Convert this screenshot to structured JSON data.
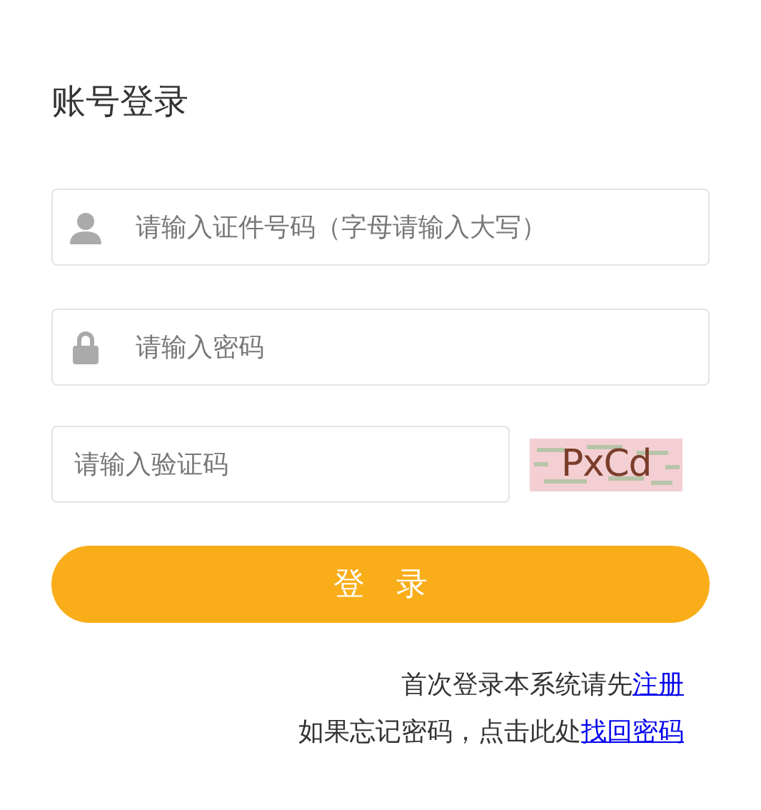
{
  "title": "账号登录",
  "fields": [
    {
      "kind": "user",
      "placeholder": "请输入证件号码（字母请输入大写）"
    },
    {
      "kind": "password",
      "placeholder": "请输入密码"
    }
  ],
  "captcha": {
    "placeholder": "请输入验证码",
    "code": "PxCd"
  },
  "login_button": "登　录",
  "links": [
    {
      "text": "首次登录本系统请先",
      "link": "注册"
    },
    {
      "text": "如果忘记密码，点击此处",
      "link": "找回密码"
    }
  ]
}
